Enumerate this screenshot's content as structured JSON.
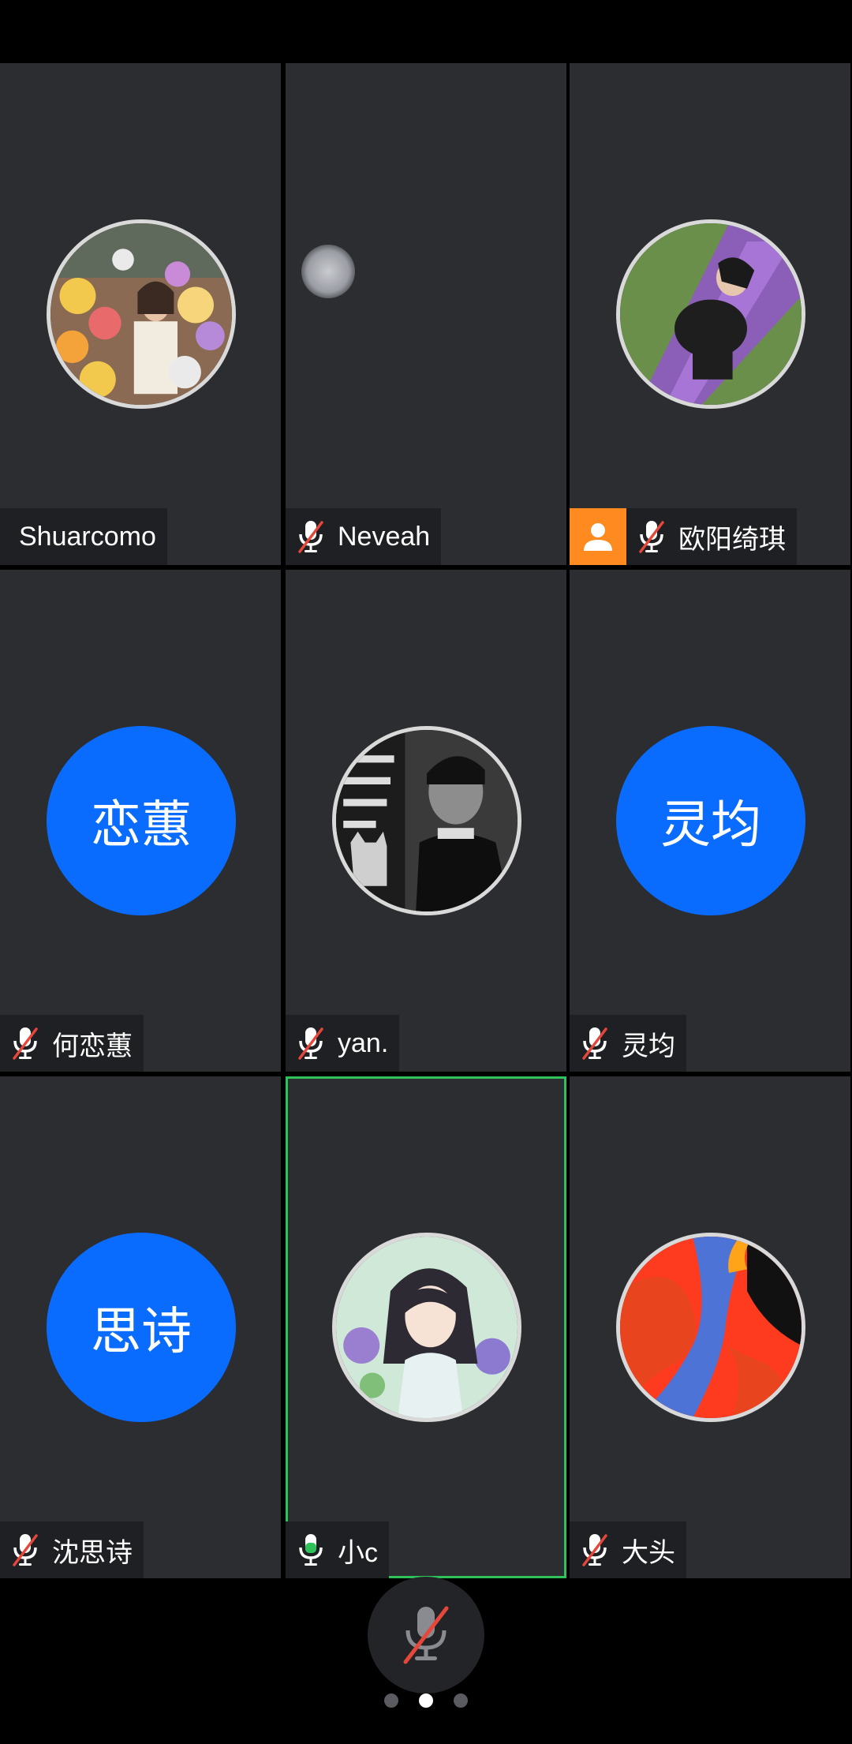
{
  "participants": [
    {
      "name": "Shuarcomo",
      "avatar_type": "photo",
      "avatar_desc": "flower-market-photo",
      "mic": "none"
    },
    {
      "name": "Neveah",
      "avatar_type": "none",
      "mic": "muted"
    },
    {
      "name": "欧阳绮琪",
      "avatar_type": "photo",
      "avatar_desc": "purple-slide-photo",
      "mic": "muted",
      "host": true
    },
    {
      "name": "何恋蕙",
      "avatar_type": "text",
      "avatar_text": "恋蕙",
      "mic": "muted"
    },
    {
      "name": "yan.",
      "avatar_type": "photo",
      "avatar_desc": "bw-portrait-photo",
      "mic": "muted"
    },
    {
      "name": "灵均",
      "avatar_type": "text",
      "avatar_text": "灵均",
      "mic": "muted"
    },
    {
      "name": "沈思诗",
      "avatar_type": "text",
      "avatar_text": "思诗",
      "mic": "muted"
    },
    {
      "name": "小c",
      "avatar_type": "photo",
      "avatar_desc": "anime-girl-illustration",
      "mic": "active",
      "speaking": true
    },
    {
      "name": "大头",
      "avatar_type": "photo",
      "avatar_desc": "abstract-color-art",
      "mic": "muted"
    }
  ],
  "controls": {
    "mute_button_icon": "mic-muted-icon"
  },
  "pagination": {
    "total": 3,
    "current": 1
  },
  "colors": {
    "tile_bg": "#2b2d30",
    "text_avatar_bg": "#0a6cff",
    "speaking_border": "#2fc25b",
    "host_badge": "#ff8a1f",
    "muted_slash": "#e5473b"
  }
}
